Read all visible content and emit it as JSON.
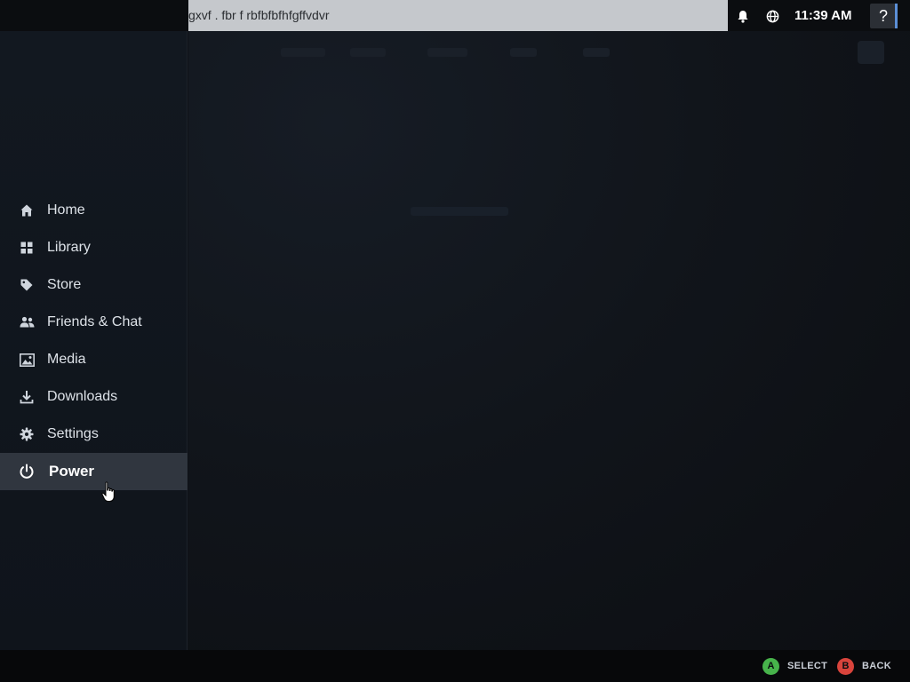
{
  "topbar": {
    "keyboard_text": "gxvf . fbr f rbfbfbfhfgffvdvr",
    "bell_icon": "bell-icon",
    "globe_icon": "globe-icon",
    "time": "11:39 AM",
    "help_label": "?"
  },
  "sidebar": {
    "items": [
      {
        "label": "Home",
        "icon": "home-icon"
      },
      {
        "label": "Library",
        "icon": "grid-icon"
      },
      {
        "label": "Store",
        "icon": "tag-icon"
      },
      {
        "label": "Friends & Chat",
        "icon": "people-icon"
      },
      {
        "label": "Media",
        "icon": "image-icon"
      },
      {
        "label": "Downloads",
        "icon": "download-icon"
      },
      {
        "label": "Settings",
        "icon": "gear-icon"
      },
      {
        "label": "Power",
        "icon": "power-icon",
        "active": true
      }
    ]
  },
  "bottombar": {
    "select_glyph": "A",
    "select_label": "SELECT",
    "back_glyph": "B",
    "back_label": "BACK"
  },
  "colors": {
    "accent": "#5b8fd6",
    "a_button": "#47b34b",
    "b_button": "#d9443c",
    "active_item_bg": "#30363f"
  }
}
